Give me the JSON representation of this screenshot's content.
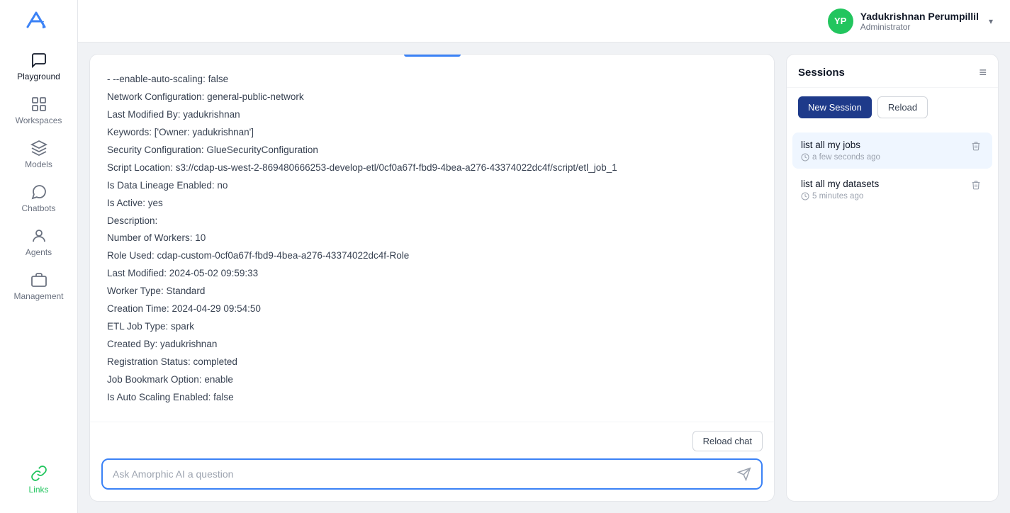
{
  "sidebar": {
    "logo_alt": "Ai Logo",
    "items": [
      {
        "id": "playground",
        "label": "Playground",
        "icon": "chat-icon",
        "active": true
      },
      {
        "id": "workspaces",
        "label": "Workspaces",
        "icon": "grid-icon",
        "active": false
      },
      {
        "id": "models",
        "label": "Models",
        "icon": "cube-icon",
        "active": false
      },
      {
        "id": "chatbots",
        "label": "Chatbots",
        "icon": "message-icon",
        "active": false
      },
      {
        "id": "agents",
        "label": "Agents",
        "icon": "person-icon",
        "active": false
      },
      {
        "id": "management",
        "label": "Management",
        "icon": "briefcase-icon",
        "active": false
      }
    ],
    "bottom_items": [
      {
        "id": "links",
        "label": "Links",
        "icon": "link-icon"
      }
    ]
  },
  "user": {
    "name": "Yadukrishnan Perumpillil",
    "role": "Administrator",
    "initials": "YP",
    "avatar_color": "#22c55e"
  },
  "chat": {
    "message_lines": [
      "- --enable-auto-scaling: false",
      "Network Configuration: general-public-network",
      "Last Modified By: yadukrishnan",
      "Keywords: ['Owner: yadukrishnan']",
      "Security Configuration: GlueSecurityConfiguration",
      "Script Location: s3://cdap-us-west-2-869480666253-develop-etl/0cf0a67f-fbd9-4bea-a276-43374022dc4f/script/etl_job_1",
      "Is Data Lineage Enabled: no",
      "Is Active: yes",
      "Description:",
      "Number of Workers: 10",
      "Role Used: cdap-custom-0cf0a67f-fbd9-4bea-a276-43374022dc4f-Role",
      "Last Modified: 2024-05-02 09:59:33",
      "Worker Type: Standard",
      "Creation Time: 2024-04-29 09:54:50",
      "ETL Job Type: spark",
      "Created By: yadukrishnan",
      "Registration Status: completed",
      "Job Bookmark Option: enable",
      "Is Auto Scaling Enabled: false"
    ],
    "reload_chat_label": "Reload chat",
    "input_placeholder": "Ask Amorphic AI a question"
  },
  "sessions": {
    "title": "Sessions",
    "new_session_label": "New Session",
    "reload_label": "Reload",
    "items": [
      {
        "id": "session1",
        "title": "list all my jobs",
        "time": "a few seconds ago",
        "active": true
      },
      {
        "id": "session2",
        "title": "list all my datasets",
        "time": "5 minutes ago",
        "active": false
      }
    ]
  }
}
